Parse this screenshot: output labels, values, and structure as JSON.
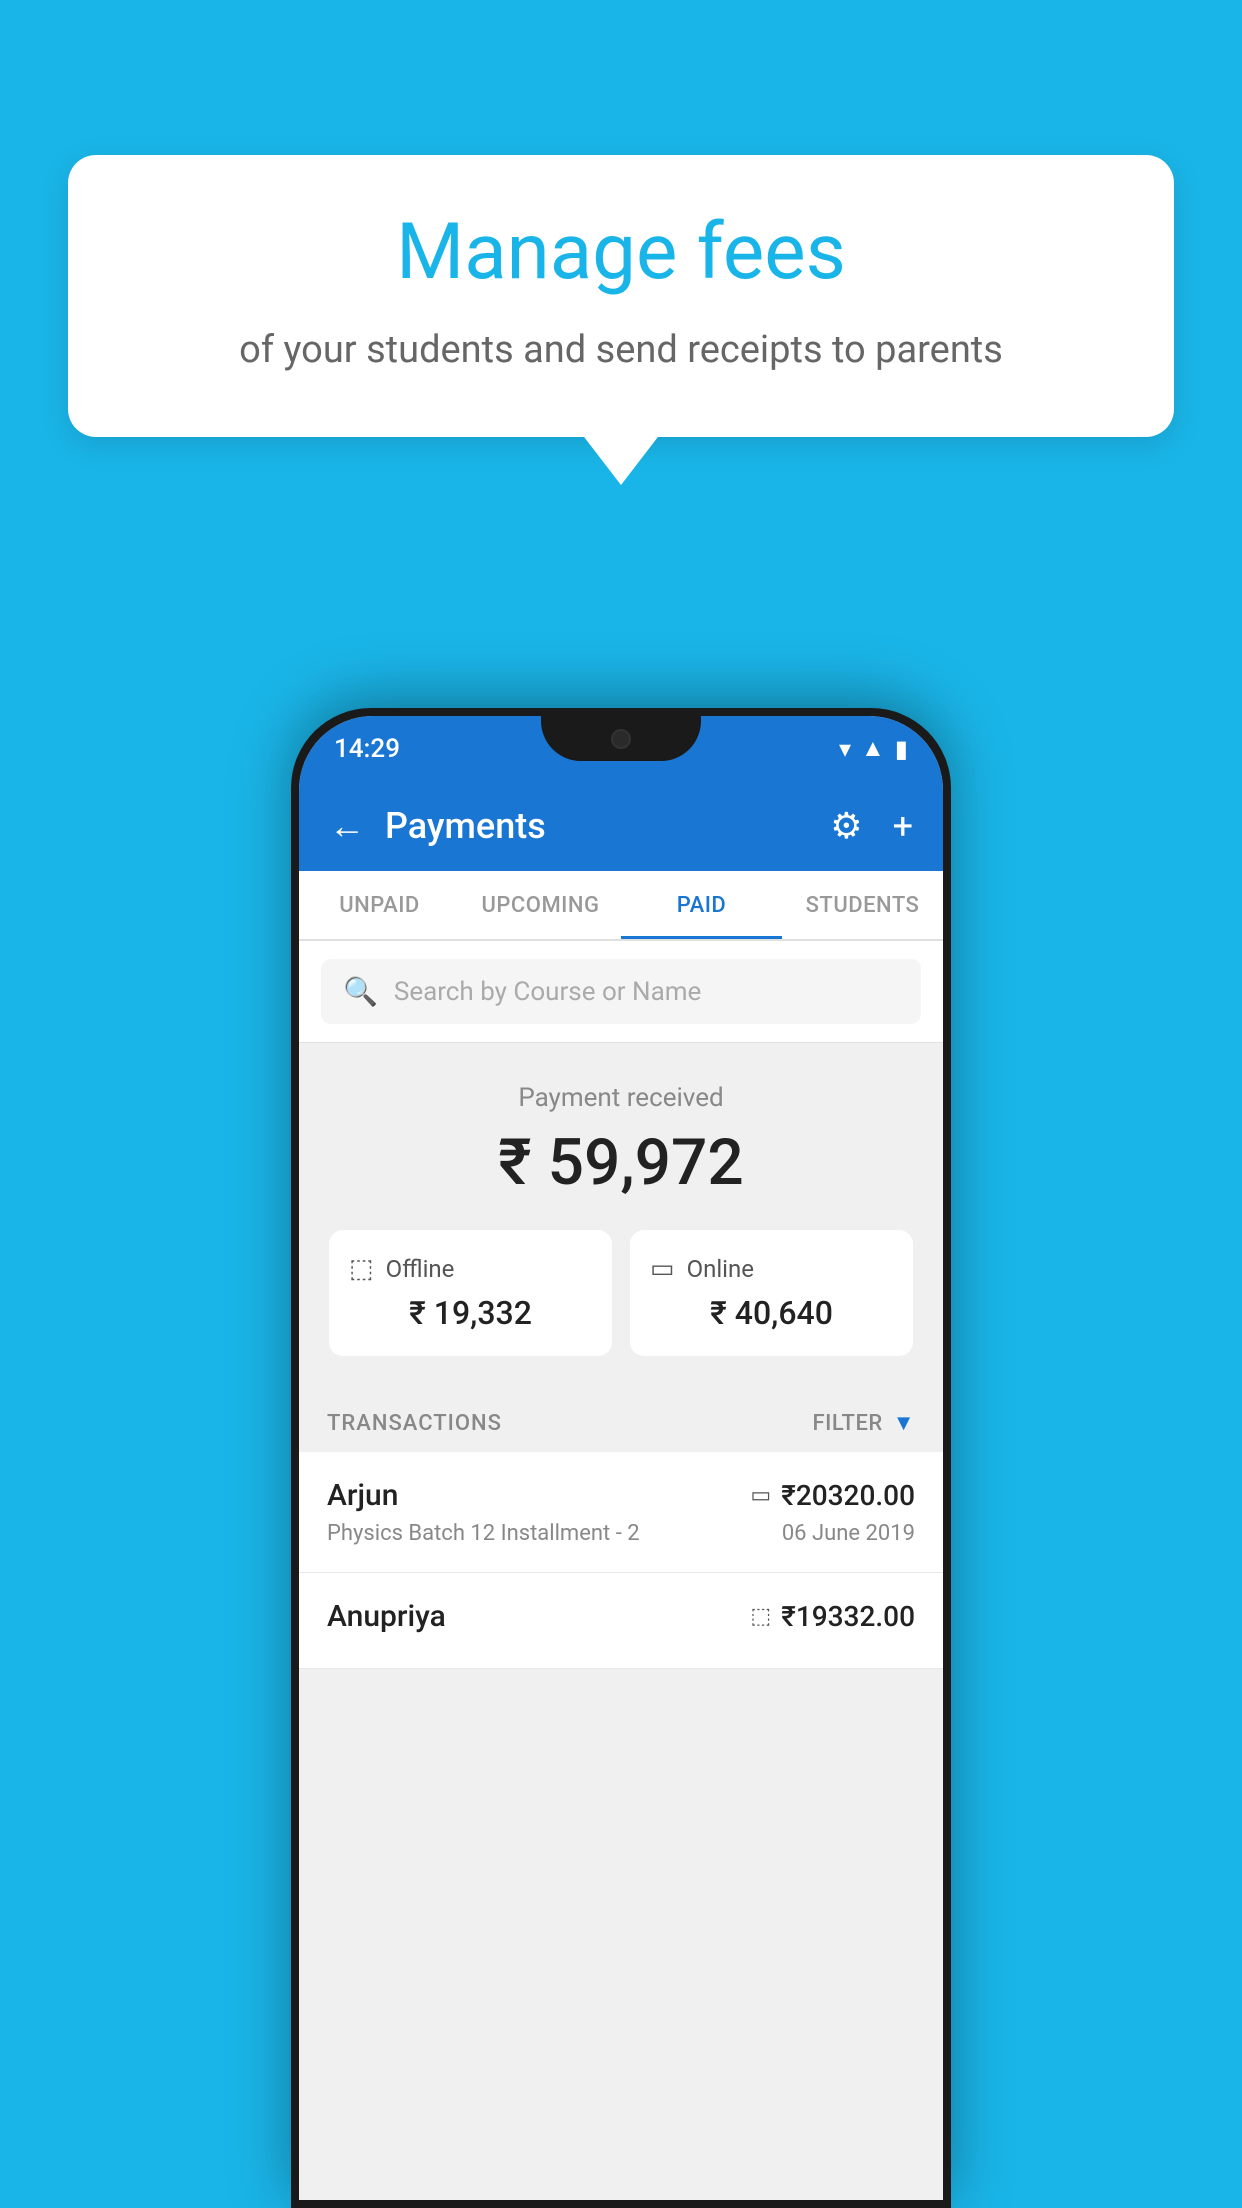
{
  "background_color": "#1ab5e8",
  "bubble": {
    "title": "Manage fees",
    "subtitle": "of your students and send receipts to parents"
  },
  "status_bar": {
    "time": "14:29",
    "icons": [
      "wifi",
      "signal",
      "battery"
    ]
  },
  "header": {
    "title": "Payments",
    "back_label": "←",
    "settings_label": "⚙",
    "add_label": "+"
  },
  "tabs": [
    {
      "label": "UNPAID",
      "active": false
    },
    {
      "label": "UPCOMING",
      "active": false
    },
    {
      "label": "PAID",
      "active": true
    },
    {
      "label": "STUDENTS",
      "active": false
    }
  ],
  "search": {
    "placeholder": "Search by Course or Name"
  },
  "payment_summary": {
    "received_label": "Payment received",
    "total_amount": "₹ 59,972",
    "offline_label": "Offline",
    "offline_amount": "₹ 19,332",
    "online_label": "Online",
    "online_amount": "₹ 40,640"
  },
  "transactions": {
    "section_label": "TRANSACTIONS",
    "filter_label": "FILTER",
    "items": [
      {
        "name": "Arjun",
        "detail": "Physics Batch 12 Installment - 2",
        "amount": "₹20320.00",
        "date": "06 June 2019",
        "pay_type": "online"
      },
      {
        "name": "Anupriya",
        "detail": "",
        "amount": "₹19332.00",
        "date": "",
        "pay_type": "offline"
      }
    ]
  }
}
